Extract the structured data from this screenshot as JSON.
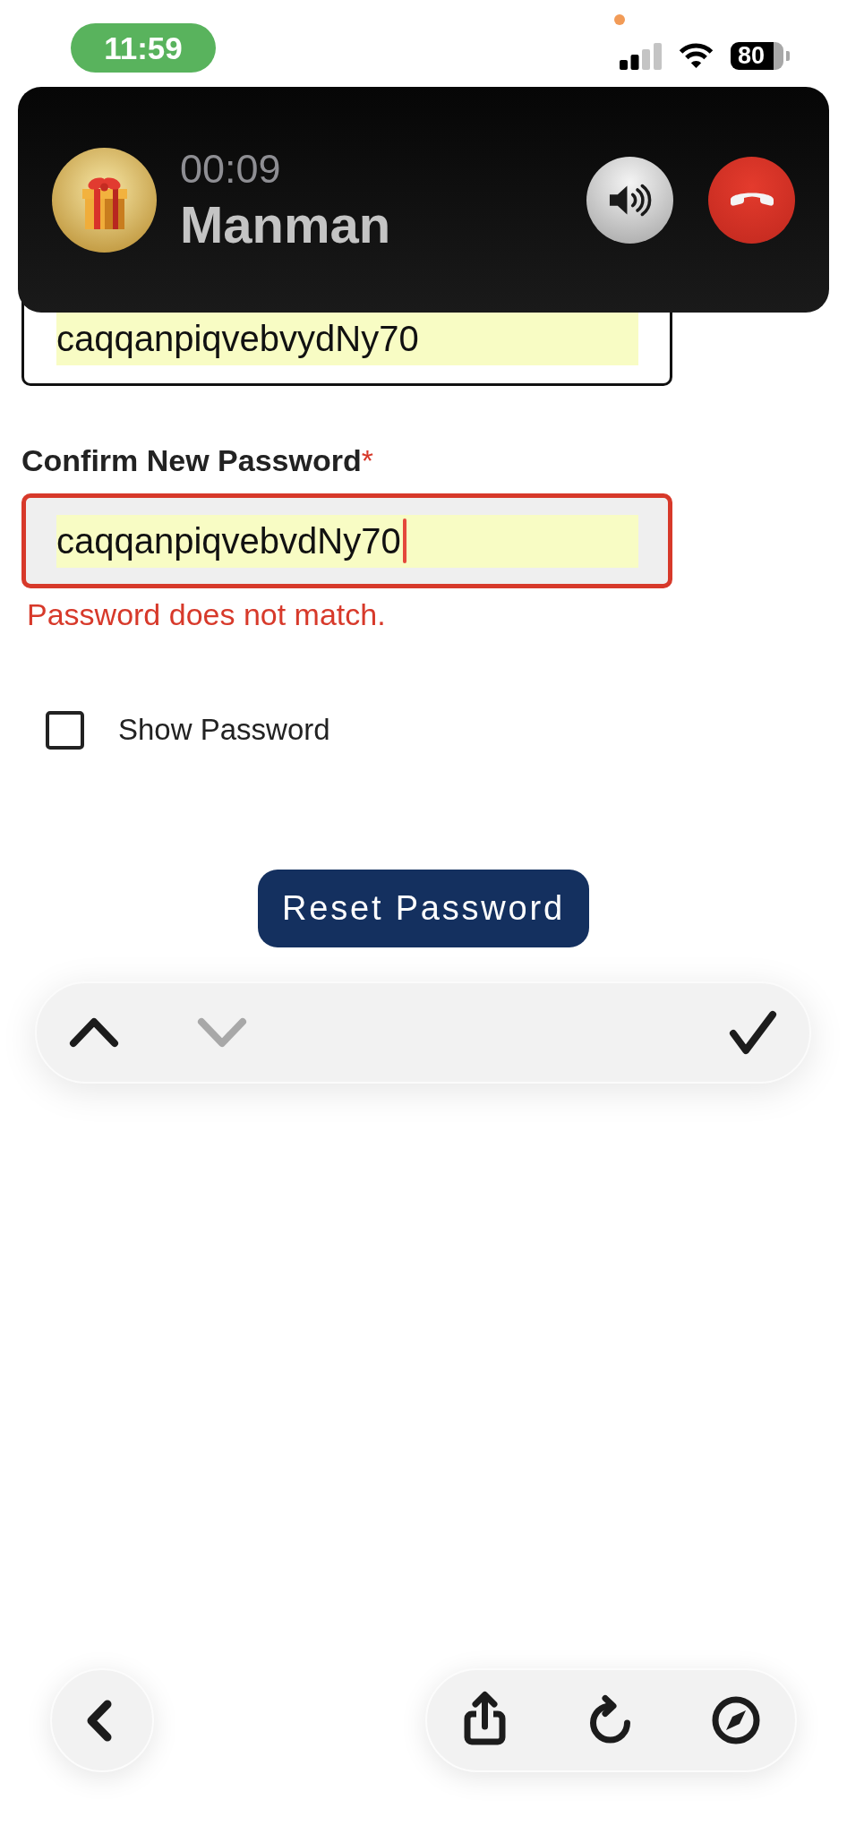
{
  "status_bar": {
    "time": "11:59",
    "battery": "80"
  },
  "call_banner": {
    "timer": "00:09",
    "caller": "Manman"
  },
  "form": {
    "fields": [
      {
        "value": "caqqanpiqvebvydNy70",
        "autofilled": true,
        "invalid": false,
        "focused": false
      },
      {
        "label": "Confirm New Password",
        "required_mark": "*",
        "value": "caqqanpiqvebvdNy70",
        "autofilled": true,
        "invalid": true,
        "focused": true,
        "error": "Password does not match."
      }
    ],
    "show_password": {
      "label": "Show Password",
      "checked": false
    },
    "submit_button": "Reset Password"
  },
  "keyboard_toolbar": {
    "items": [
      {
        "kind": "previous",
        "disabled": false
      },
      {
        "kind": "next",
        "disabled": true
      },
      {
        "kind": "done",
        "disabled": false
      }
    ]
  }
}
